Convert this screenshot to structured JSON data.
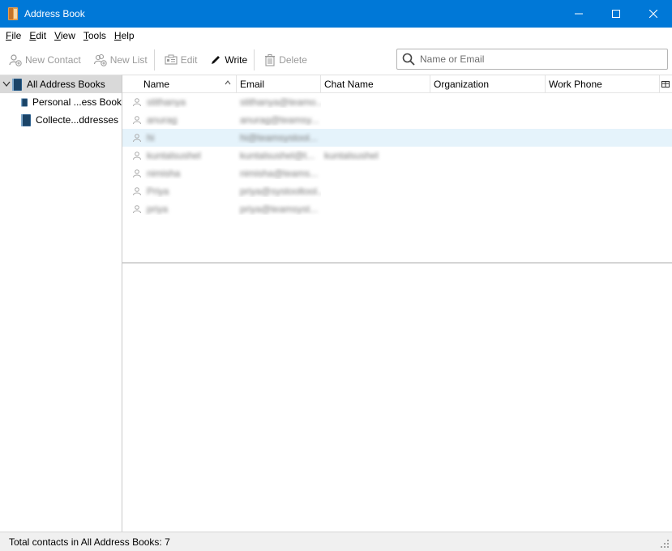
{
  "window": {
    "title": "Address Book",
    "accent_color": "#0078d7",
    "controls": [
      "minimize",
      "maximize",
      "close"
    ]
  },
  "menu": [
    {
      "label": "File",
      "underline": "F"
    },
    {
      "label": "Edit",
      "underline": "E"
    },
    {
      "label": "View",
      "underline": "V"
    },
    {
      "label": "Tools",
      "underline": "T"
    },
    {
      "label": "Help",
      "underline": "H"
    }
  ],
  "toolbar": {
    "new_contact": "New Contact",
    "new_list": "New List",
    "edit": "Edit",
    "write": "Write",
    "delete": "Delete"
  },
  "search": {
    "placeholder": "Name or Email",
    "value": ""
  },
  "sidebar": {
    "items": [
      {
        "label": "All Address Books",
        "icon": "address-book-icon",
        "selected": true
      },
      {
        "label": "Personal ...ess Book",
        "icon": "book-icon"
      },
      {
        "label": "Collecte...ddresses",
        "icon": "book-icon"
      }
    ]
  },
  "columns": [
    "Name",
    "Email",
    "Chat Name",
    "Organization",
    "Work Phone"
  ],
  "contacts": [
    {
      "name": "stithanya",
      "email": "stithanya@teamo...",
      "chat": ""
    },
    {
      "name": "anurag",
      "email": "anurag@teamsy...",
      "chat": ""
    },
    {
      "name": "hi",
      "email": "hi@teamsystool...",
      "chat": ""
    },
    {
      "name": "kuntalsushel",
      "email": "kuntalsushel@t...",
      "chat": "kuntalsushel"
    },
    {
      "name": "nimisha",
      "email": "nimisha@teams...",
      "chat": ""
    },
    {
      "name": "Priya",
      "email": "priya@systooltool...",
      "chat": ""
    },
    {
      "name": "priya",
      "email": "priya@teamsyst...",
      "chat": ""
    }
  ],
  "status": {
    "text": "Total contacts in All Address Books: 7"
  }
}
